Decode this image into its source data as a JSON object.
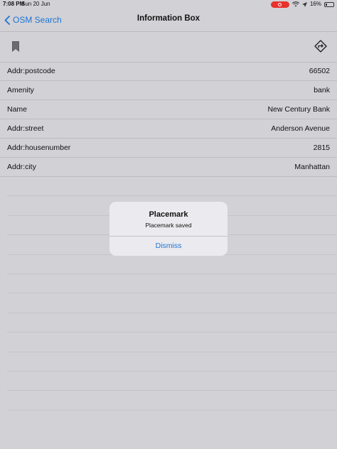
{
  "status_bar": {
    "time": "7:08 PM",
    "date": "Sun 20 Jun",
    "battery": "16%"
  },
  "nav": {
    "back_label": "OSM Search",
    "title": "Information Box"
  },
  "toolbar": {
    "left_icon": "bookmark-icon",
    "right_icon": "directions-icon"
  },
  "rows": [
    {
      "key": "Addr:postcode",
      "value": "66502"
    },
    {
      "key": "Amenity",
      "value": "bank"
    },
    {
      "key": "Name",
      "value": "New Century Bank"
    },
    {
      "key": "Addr:street",
      "value": "Anderson Avenue"
    },
    {
      "key": "Addr:housenumber",
      "value": "2815"
    },
    {
      "key": "Addr:city",
      "value": "Manhattan"
    }
  ],
  "alert": {
    "title": "Placemark",
    "message": "Placemark saved",
    "button": "Dismiss"
  },
  "colors": {
    "accent": "#1a74d6",
    "background": "#d2d1d6",
    "record_indicator": "#e8322c"
  }
}
